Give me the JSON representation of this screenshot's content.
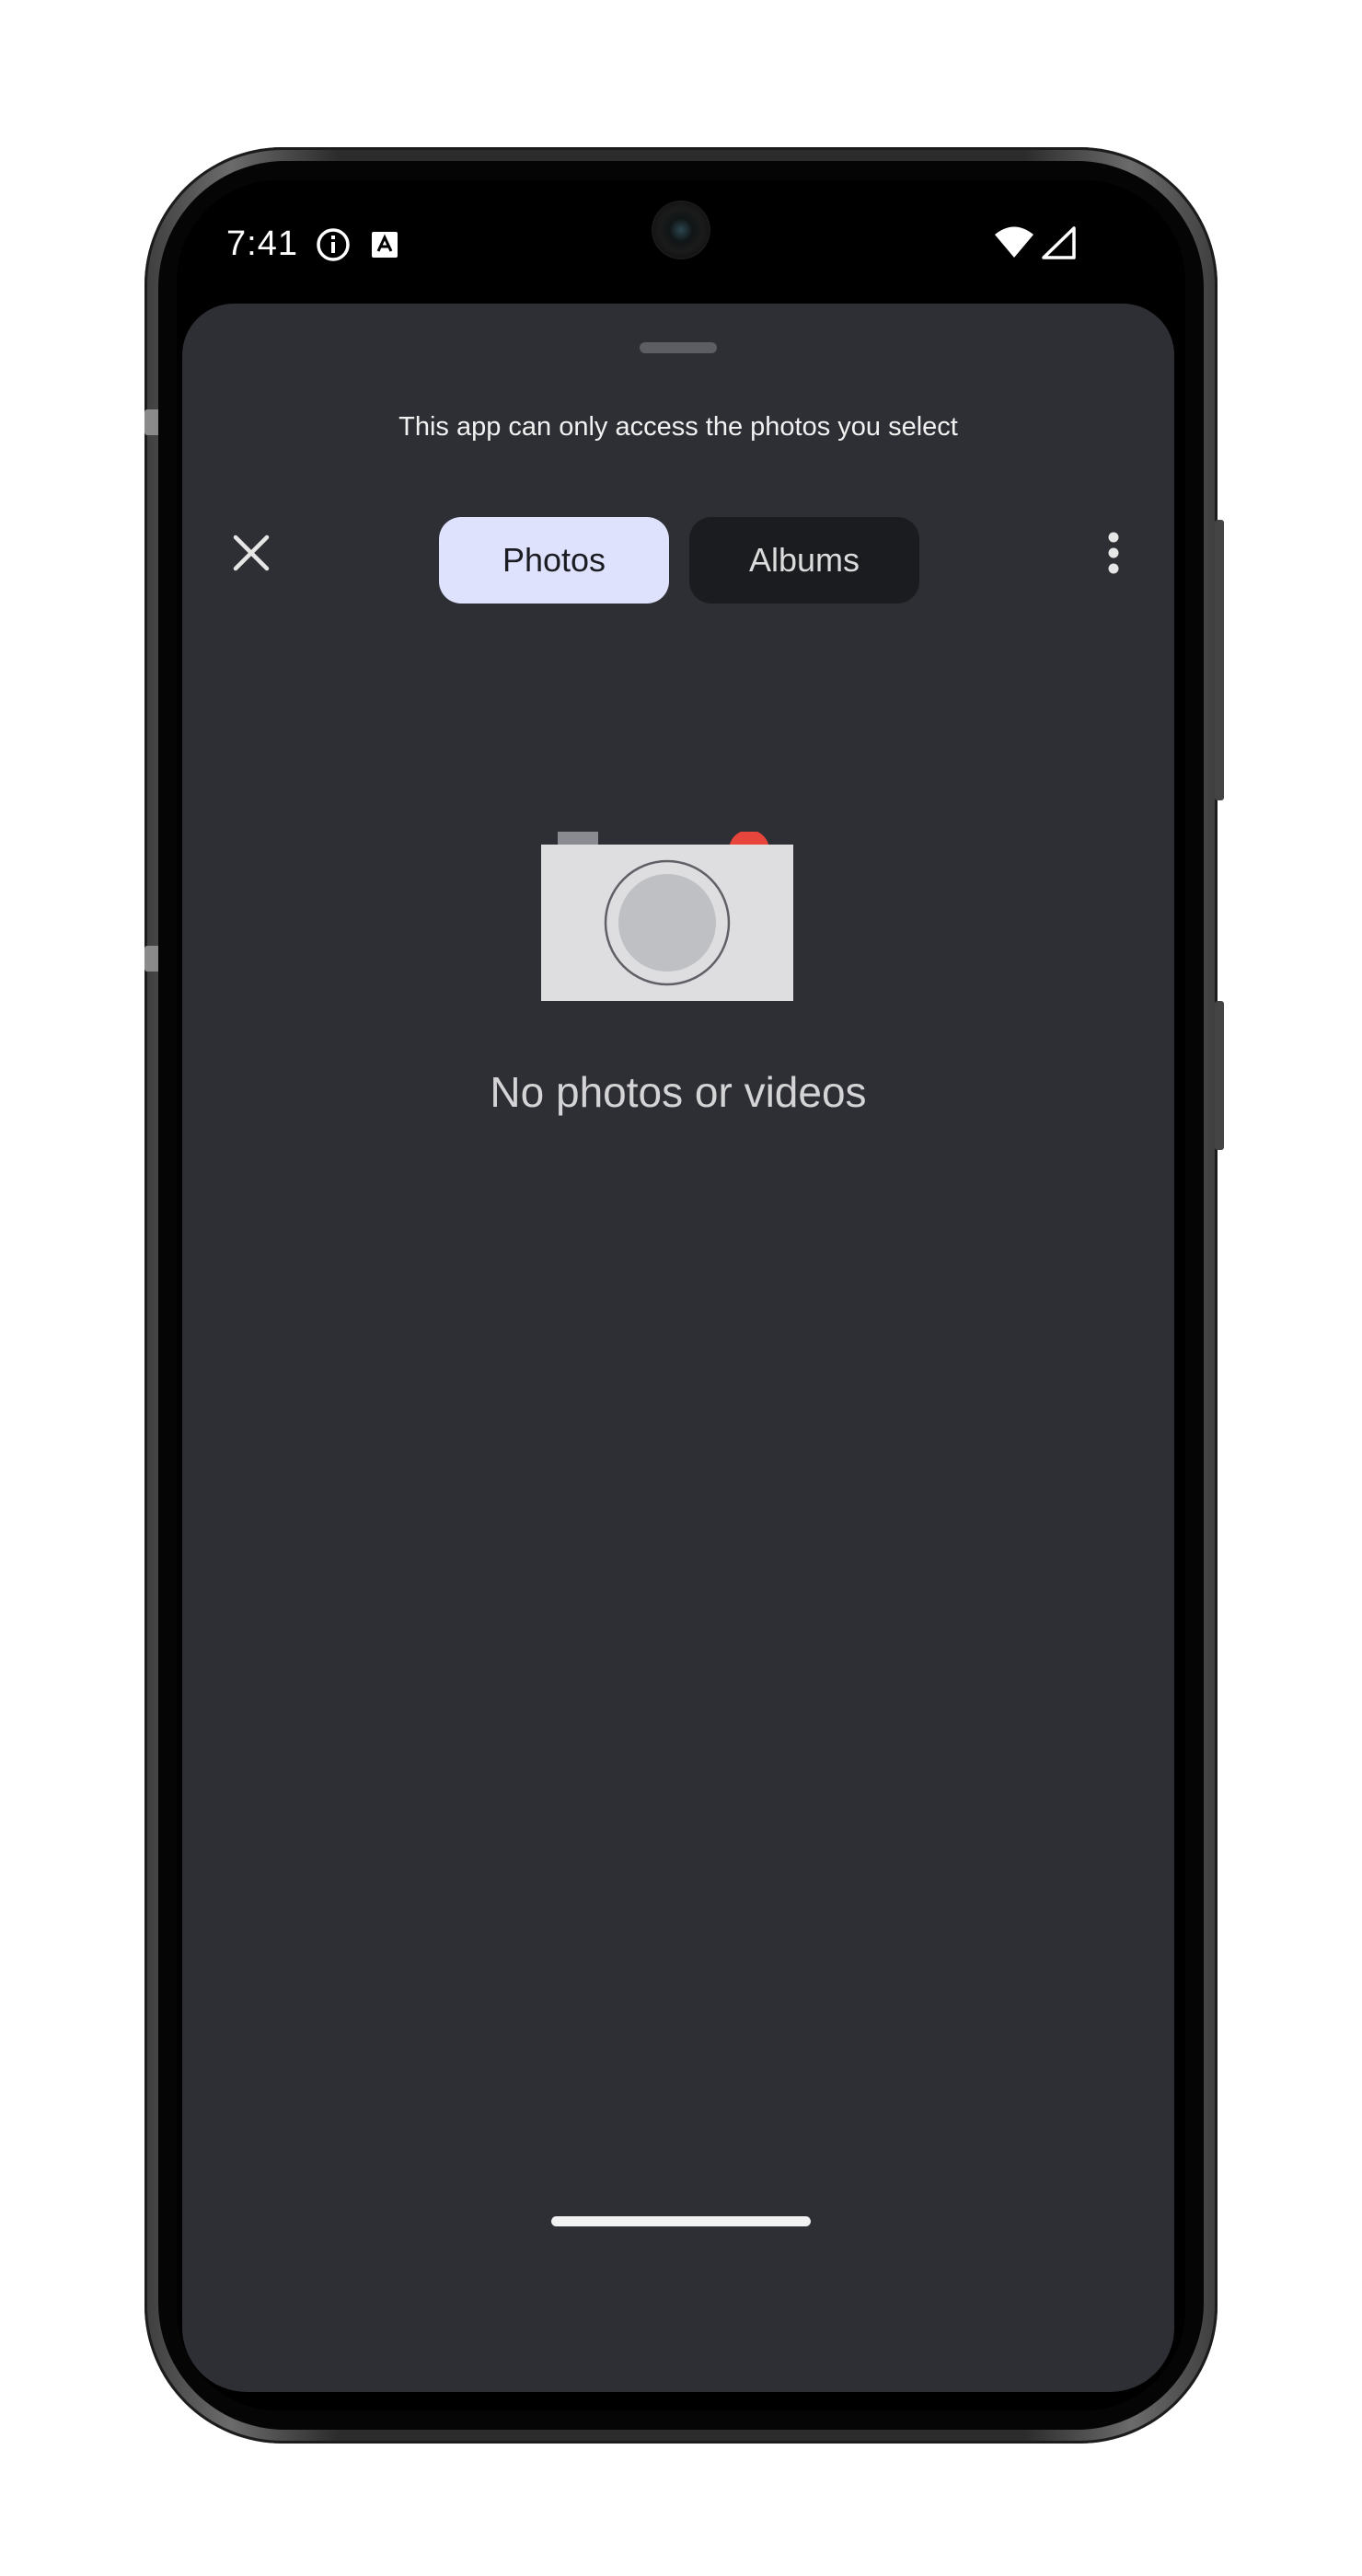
{
  "status_bar": {
    "time": "7:41",
    "icons": [
      "info-icon",
      "accessibility-a-icon",
      "wifi-icon",
      "cellular-signal-icon"
    ]
  },
  "picker": {
    "notice": "This app can only access the photos you select",
    "close_icon": "close-icon",
    "more_icon": "more-vertical-icon",
    "tabs": [
      {
        "label": "Photos",
        "selected": true
      },
      {
        "label": "Albums",
        "selected": false
      }
    ],
    "empty_state": {
      "icon": "camera-icon",
      "message": "No photos or videos"
    }
  },
  "colors": {
    "sheet_background": "#2e2f34",
    "active_tab_background": "#dee2fd",
    "inactive_tab_background": "#1b1c20",
    "camera_accent": "#e8453c"
  }
}
